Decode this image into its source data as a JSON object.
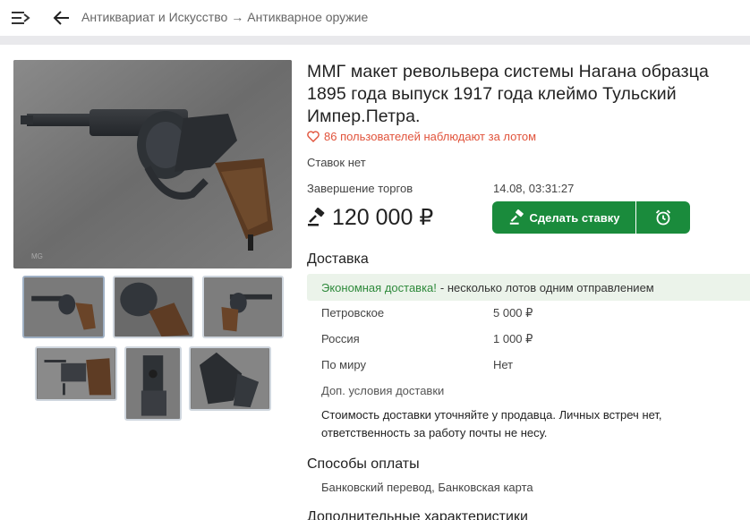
{
  "header": {
    "menu_icon": "menu-icon",
    "back_icon": "arrow-back-icon",
    "breadcrumb": {
      "first": "Антиквариат и Искусство",
      "separator": "→",
      "second": "Антикварное оружие"
    }
  },
  "lot": {
    "title": "ММГ макет револьвера системы Нагана образца 1895 года выпуск 1917 года клеймо Тульский Импер.Петра.",
    "watchers": "86 пользователей наблюдают за лотом",
    "bids": "Ставок нет",
    "end_label": "Завершение торгов",
    "end_value": "14.08, 03:31:27",
    "price": "120 000 ₽",
    "bid_button": "Сделать ставку"
  },
  "delivery": {
    "heading": "Доставка",
    "promo_highlight": "Экономная доставка!",
    "promo_text": "- несколько лотов одним отправлением",
    "rows": [
      {
        "label": "Петровское",
        "value": "5 000 ₽"
      },
      {
        "label": "Россия",
        "value": "1 000 ₽"
      },
      {
        "label": "По миру",
        "value": "Нет"
      }
    ],
    "conditions_label": "Доп. условия доставки",
    "conditions_text": "Стоимость доставки уточняйте у продавца. Личных встреч нет, ответственность за работу почты не несу."
  },
  "payment": {
    "heading": "Способы оплаты",
    "text": "Банковский перевод, Банковская карта"
  },
  "extra": {
    "heading": "Дополнительные характеристики"
  },
  "colors": {
    "accent_green": "#1a8b3c",
    "watch_red": "#e1533b",
    "promo_bg": "#ebf3ea",
    "promo_green": "#2f8a3c"
  }
}
